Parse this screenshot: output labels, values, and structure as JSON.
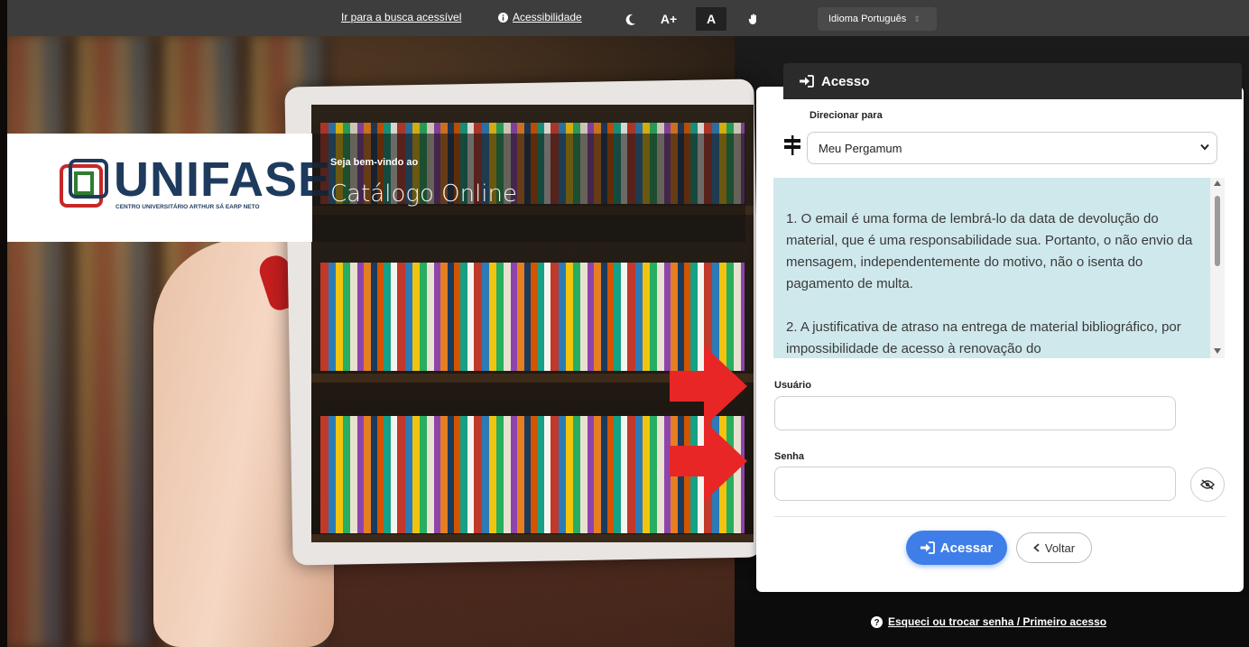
{
  "topbar": {
    "accessible_search": "Ir para a busca acessível",
    "accessibility": "Acessibilidade",
    "font_increase": "A+",
    "font_default": "A",
    "language": "Idioma Português"
  },
  "brand": {
    "name": "UNIFASE",
    "subtitle": "CENTRO UNIVERSITÁRIO ARTHUR SÁ EARP NETO",
    "welcome_small": "Seja bem-vindo ao",
    "welcome_big": "Catálogo Online"
  },
  "login": {
    "header": "Acesso",
    "redirect_label": "Direcionar para",
    "redirect_value": "Meu Pergamum",
    "notice_1": "1. O email é uma forma de lembrá-lo da data de devolução do material, que é uma responsabilidade sua. Portanto, o não envio da mensagem, independentemente do motivo, não o isenta do pagamento de multa.",
    "notice_2": "2. A justificativa de atraso na entrega de material bibliográfico, por impossibilidade de acesso à renovação do",
    "user_label": "Usuário",
    "password_label": "Senha",
    "submit_label": "Acessar",
    "back_label": "Voltar",
    "forgot_link": "Esqueci ou trocar senha / Primeiro acesso"
  },
  "colors": {
    "accent": "#3f7ee8",
    "header_dark": "#2b2b2b",
    "notice_bg": "#cfe8ec",
    "arrow": "#e82626"
  }
}
